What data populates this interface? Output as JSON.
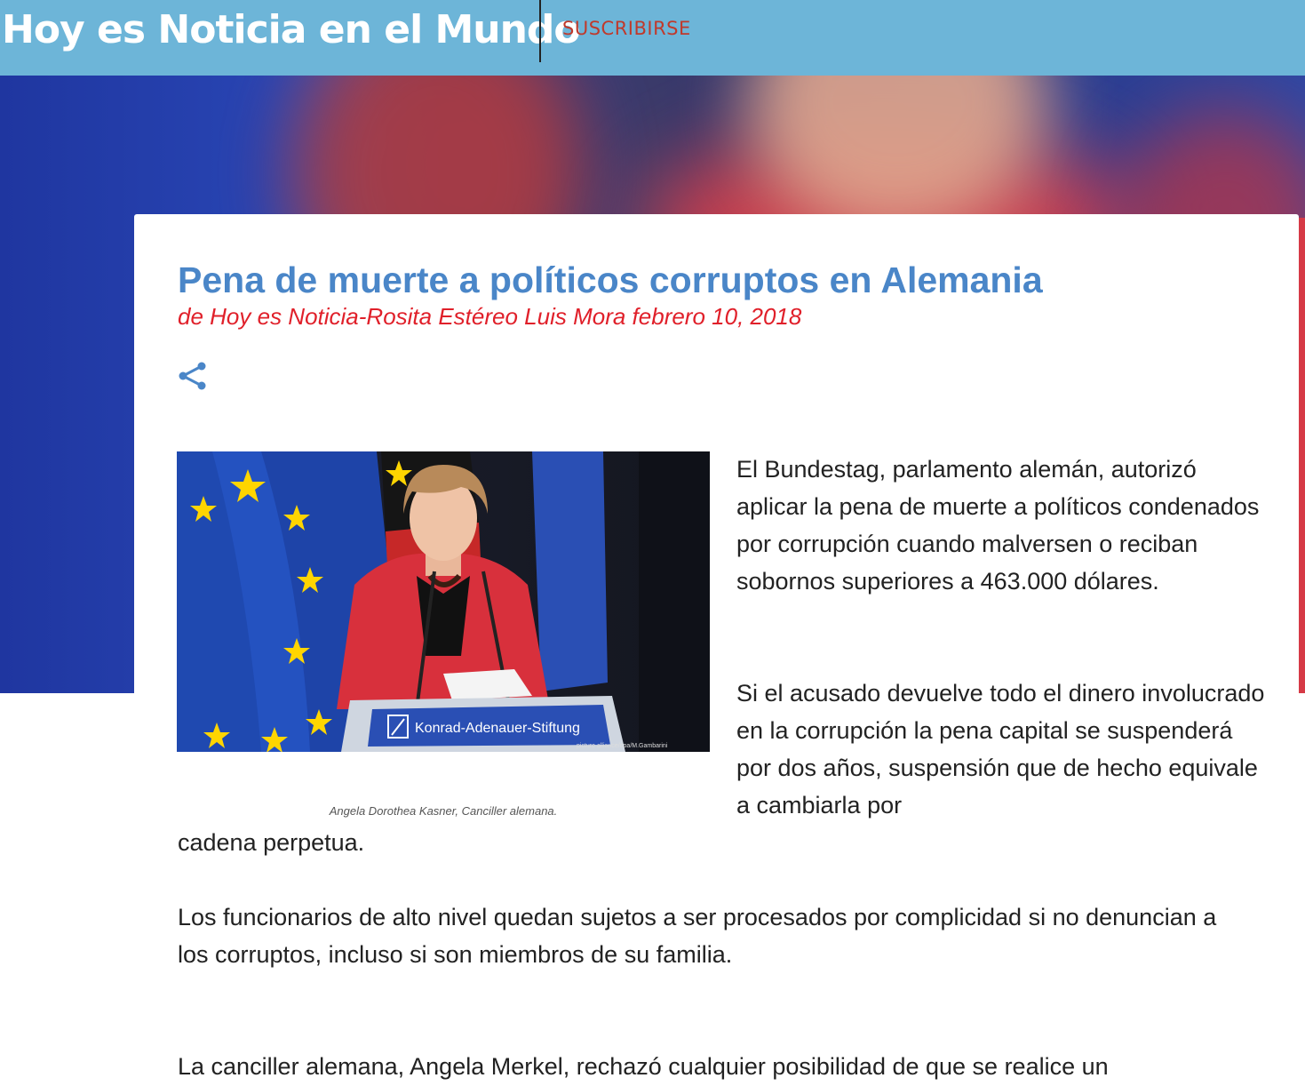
{
  "header": {
    "site_title": "Hoy es Noticia en el Mundo",
    "subscribe_label": "SUSCRIBIRSE"
  },
  "post": {
    "title": "Pena de muerte a políticos corruptos en Alemania",
    "byline": "de Hoy es Noticia-Rosita Estéreo Luis Mora febrero 10, 2018",
    "share_icon": "share-icon",
    "image": {
      "podium_text": "Konrad-Adenauer-Stiftung",
      "credit": "picture alliance/dpa/M.Gambarini",
      "caption": "Angela Dorothea Kasner, Canciller alemana."
    },
    "paragraphs": {
      "p1": "El Bundestag, parlamento alemán, autorizó aplicar la pena de muerte a políticos condenados por corrupción cuando malversen o reciban sobornos superiores a 463.000 dólares.",
      "p2_top": "Si el acusado devuelve todo el dinero involucrado en la corrupción la pena capital se suspenderá por dos años, suspensión que de hecho equivale a cambiarla por",
      "p2_bottom": "cadena perpetua.",
      "p3": "Los funcionarios de alto nivel quedan sujetos a ser procesados por complicidad si no denuncian a los corruptos, incluso si son miembros de su familia.",
      "p4": "La canciller alemana, Angela Merkel, rechazó cualquier posibilidad de que se realice un"
    }
  },
  "colors": {
    "header_bg": "#6db5d8",
    "title_blue": "#4a86c8",
    "byline_red": "#e0202a",
    "subscribe_red": "#c0392b"
  }
}
